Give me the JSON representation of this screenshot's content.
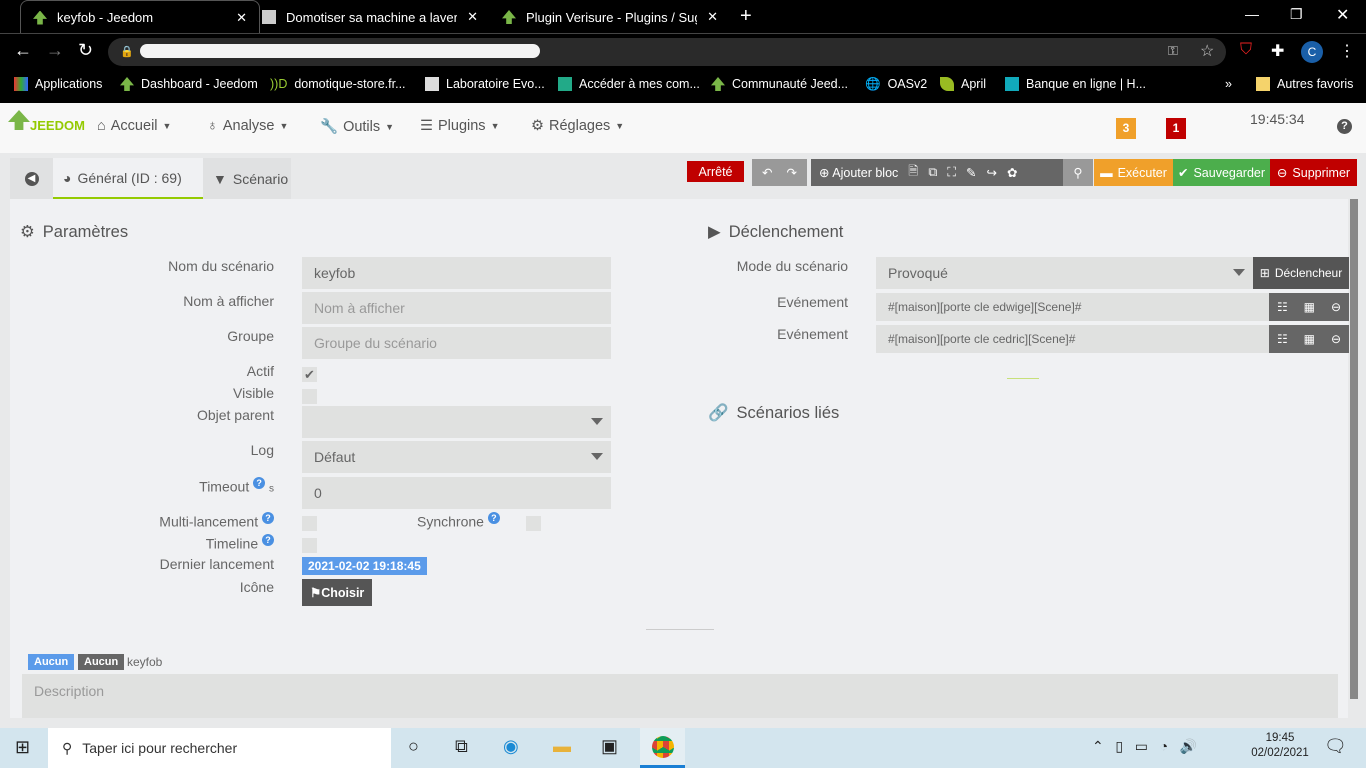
{
  "browser": {
    "tabs": [
      {
        "title": "keyfob - Jeedom"
      },
      {
        "title": "Domotiser sa machine a laver via"
      },
      {
        "title": "Plugin Verisure - Plugins / Sugge"
      }
    ],
    "bookmarks": [
      "Applications",
      "Dashboard - Jeedom",
      "domotique-store.fr...",
      "Laboratoire Evo...",
      "Accéder à mes com...",
      "Communauté Jeed...",
      "OASv2",
      "April",
      "Banque en ligne | H..."
    ],
    "more_bookmarks": "»",
    "other_bookmarks": "Autres favoris",
    "profile_initial": "C"
  },
  "navbar": {
    "logo": "JEEDOM",
    "menus": [
      "Accueil",
      "Analyse",
      "Outils",
      "Plugins",
      "Réglages"
    ],
    "badge_orange": "3",
    "badge_red": "1",
    "clock": "19:45:34",
    "colors": {
      "accent": "#94ca02",
      "orange": "#f0a02a",
      "red": "#c00000"
    }
  },
  "tabs": {
    "general": "Général (ID : 69)",
    "scenario": "Scénario"
  },
  "toolbar": {
    "state": "Arrêté",
    "add_block": "Ajouter bloc",
    "execute": "Exécuter",
    "save": "Sauvegarder",
    "delete": "Supprimer"
  },
  "params": {
    "title": "Paramètres",
    "name_label": "Nom du scénario",
    "name_value": "keyfob",
    "display_label": "Nom à afficher",
    "display_placeholder": "Nom à afficher",
    "group_label": "Groupe",
    "group_placeholder": "Groupe du scénario",
    "active_label": "Actif",
    "visible_label": "Visible",
    "parent_label": "Objet parent",
    "log_label": "Log",
    "log_value": "Défaut",
    "timeout_label": "Timeout",
    "timeout_unit": "s",
    "timeout_value": "0",
    "multi_label": "Multi-lancement",
    "sync_label": "Synchrone",
    "timeline_label": "Timeline",
    "last_label": "Dernier lancement",
    "last_value": "2021-02-02 19:18:45",
    "icon_label": "Icône",
    "choose": "Choisir"
  },
  "trigger": {
    "title": "Déclenchement",
    "mode_label": "Mode du scénario",
    "mode_value": "Provoqué",
    "add_trigger": "Déclencheur",
    "events": [
      {
        "label": "Evénement",
        "value": "#[maison][porte cle edwige][Scene]#"
      },
      {
        "label": "Evénement",
        "value": "#[maison][porte cle cedric][Scene]#"
      }
    ]
  },
  "linked": {
    "title": "Scénarios liés"
  },
  "footer": {
    "tag1": "Aucun",
    "tag2": "Aucun",
    "name": "keyfob",
    "description_placeholder": "Description"
  },
  "taskbar": {
    "search_placeholder": "Taper ici pour rechercher",
    "time": "19:45",
    "date": "02/02/2021"
  }
}
